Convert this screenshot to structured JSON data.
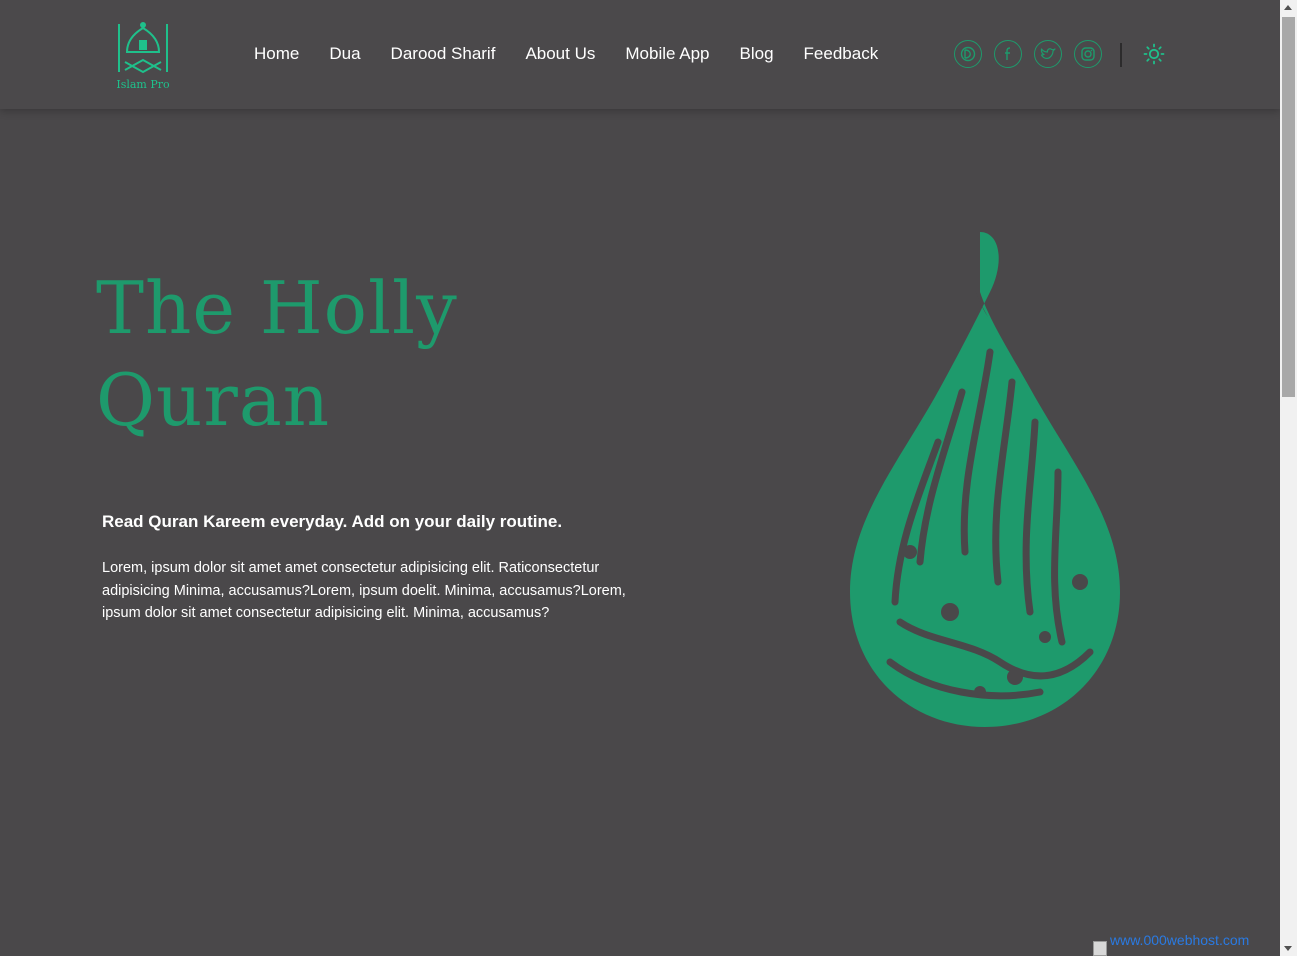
{
  "brand": {
    "logo_text": "Islam Pro",
    "accent_color": "#1e9a6c",
    "background_color": "#4a484a"
  },
  "nav": {
    "items": [
      {
        "label": "Home"
      },
      {
        "label": "Dua"
      },
      {
        "label": "Darood Sharif"
      },
      {
        "label": "About Us"
      },
      {
        "label": "Mobile App"
      },
      {
        "label": "Blog"
      },
      {
        "label": "Feedback"
      }
    ]
  },
  "social": [
    "dribbble-icon",
    "facebook-icon",
    "twitter-icon",
    "instagram-icon"
  ],
  "theme_toggle_icon": "sun-icon",
  "hero": {
    "title_line1": "The Holly",
    "title_line2": "Quran",
    "subtitle": "Read Quran Kareem everyday. Add on your daily routine.",
    "paragraph": "Lorem, ipsum dolor sit amet amet consectetur adipisicing elit. Raticonsectetur adipisicing Minima, accusamus?Lorem, ipsum doelit. Minima, accusamus?Lorem, ipsum dolor sit amet consectetur adipisicing elit. Minima, accusamus?",
    "calligraphy": "Al-Quran al-Kareem calligraphy"
  },
  "host_badge": {
    "text": "www.000webhost.com"
  }
}
